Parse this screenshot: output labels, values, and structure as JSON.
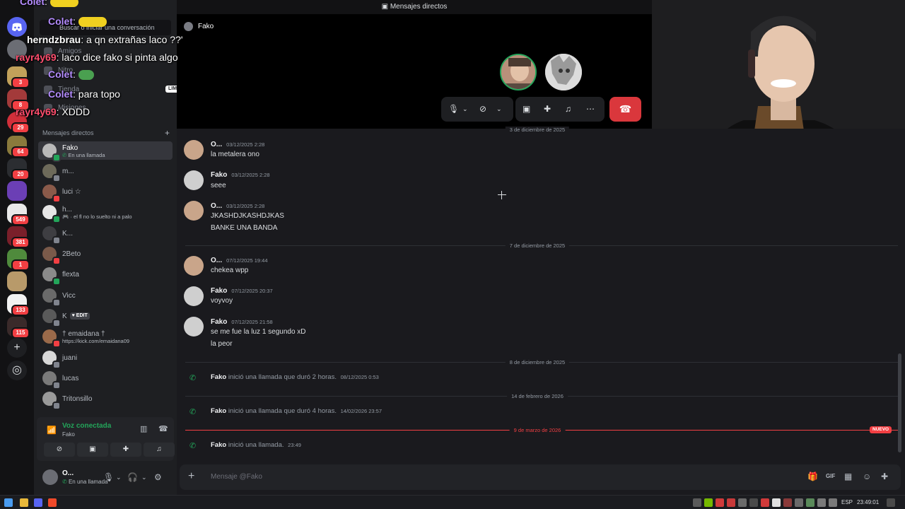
{
  "window": {
    "title": "Mensajes directos"
  },
  "sidebar": {
    "search_placeholder": "Buscar o iniciar una conversación",
    "search_partial": "Buscar",
    "search_tail": "a conversación",
    "nav": [
      "Amigos",
      "Nitro",
      "Tienda",
      "Misiones"
    ],
    "tienda_badge": "LIMITADA",
    "dm_header": "Mensajes directos",
    "dms": [
      {
        "name": "Fako",
        "sub": "En una llamada"
      },
      {
        "name": "m..."
      },
      {
        "name": "luci ☆"
      },
      {
        "name": "h...",
        "sub": "· el fl no lo suelto ni a palo"
      },
      {
        "name": "K..."
      },
      {
        "name": "2Beto"
      },
      {
        "name": "flexta"
      },
      {
        "name": "Vicc"
      },
      {
        "name": "K",
        "tag": "EDIT"
      },
      {
        "name": "† emaidana †",
        "sub": "https://kick.com/emaidana09"
      },
      {
        "name": "juani"
      },
      {
        "name": "lucas"
      },
      {
        "name": "Tritonsillo"
      }
    ],
    "voice": {
      "title": "Voz conectada",
      "channel": "Fako"
    },
    "user": {
      "name": "O...",
      "status": "En una llamada"
    }
  },
  "rail": {
    "badges": [
      "3",
      "8",
      "29",
      "64",
      "20",
      "549",
      "381",
      "1",
      "133",
      "115"
    ]
  },
  "call": {
    "title": "Fako"
  },
  "messages": {
    "separators": [
      {
        "label": "3 de diciembre de 2025"
      },
      {
        "label": "7 de diciembre de 2025"
      },
      {
        "label": "8 de diciembre de 2025"
      },
      {
        "label": "14 de febrero de 2026"
      },
      {
        "label": "9 de marzo de 2026",
        "new_badge": "NUEVO"
      }
    ],
    "items": [
      {
        "author": "O...",
        "time": "03/12/2025 2:28",
        "lines": [
          "la metalera ono"
        ]
      },
      {
        "author": "Fako",
        "time": "03/12/2025 2:28",
        "lines": [
          "seee"
        ]
      },
      {
        "author": "O...",
        "time": "03/12/2025 2:28",
        "lines": [
          "JKASHDJKASHDJKAS",
          "BANKE UNA BANDA"
        ]
      },
      {
        "author": "O...",
        "time": "07/12/2025 19:44",
        "lines": [
          "chekea wpp"
        ]
      },
      {
        "author": "Fako",
        "time": "07/12/2025 20:37",
        "lines": [
          "voyvoy"
        ]
      },
      {
        "author": "Fako",
        "time": "07/12/2025 21:58",
        "lines": [
          "se me fue la luz 1 segundo xD",
          "la peor"
        ]
      }
    ],
    "calls": [
      {
        "author": "Fako",
        "text": "inició una llamada que duró 2 horas.",
        "time": "08/12/2025 0:53"
      },
      {
        "author": "Fako",
        "text": "inició una llamada que duró 4 horas.",
        "time": "14/02/2026 23:57"
      },
      {
        "author": "Fako",
        "text": "inició una llamada.",
        "time": "23:49"
      }
    ]
  },
  "composer": {
    "placeholder": "Mensaje @Fako"
  },
  "overlay_chat": [
    {
      "user": "Colet",
      "text": "",
      "color": "#b48cff"
    },
    {
      "user": "Colet",
      "text": "",
      "color": "#b48cff"
    },
    {
      "user": "herndzbrau",
      "text": "a qn extrañas laco ??'",
      "color": "#ffffff"
    },
    {
      "user": "rayr4y69",
      "text": "laco dice fako si pinta algo",
      "color": "#ff4d6d"
    },
    {
      "user": "Colet",
      "text": "",
      "color": "#b48cff"
    },
    {
      "user": "Colet",
      "text": "para topo",
      "color": "#b48cff"
    },
    {
      "user": "rayr4y69",
      "text": "XDDD",
      "color": "#ff4d6d"
    }
  ],
  "taskbar": {
    "lang": "ESP",
    "time": "23:49:01"
  },
  "colors": {
    "accent": "#5865f2",
    "online": "#23a55a",
    "danger": "#da373c"
  }
}
